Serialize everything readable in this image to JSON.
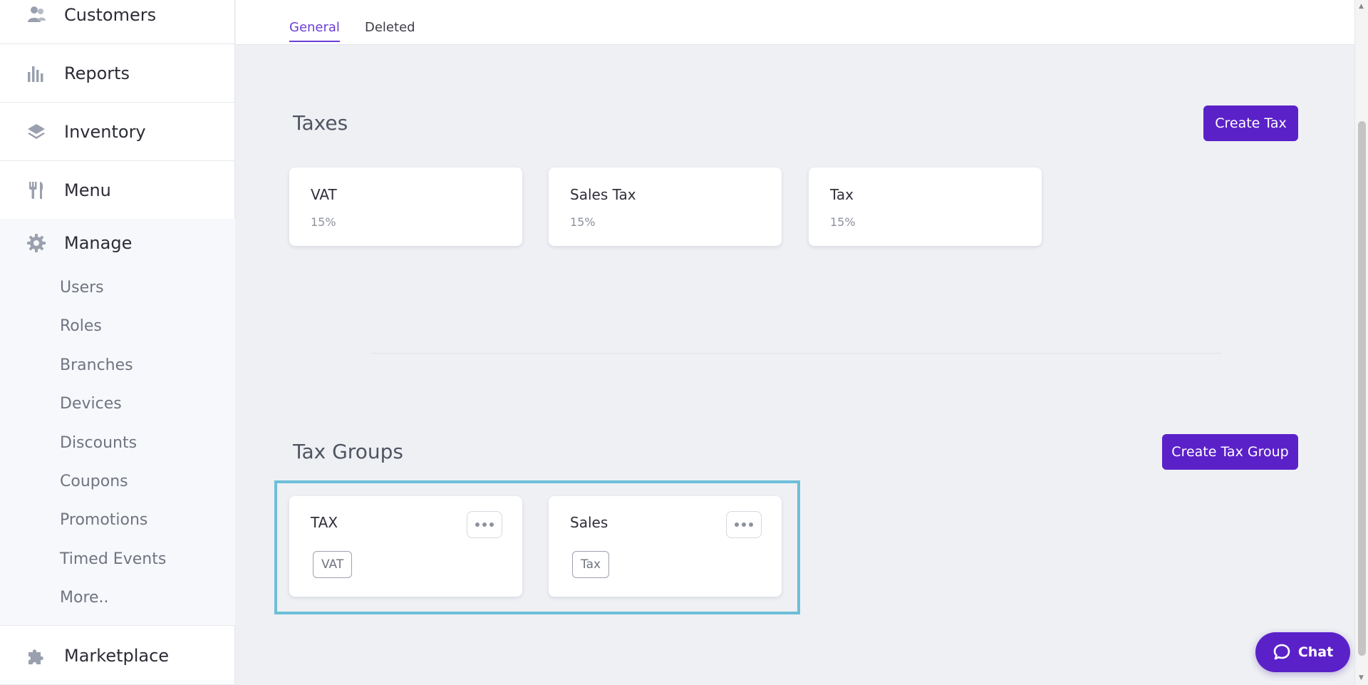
{
  "sidebar": {
    "customers": "Customers",
    "reports": "Reports",
    "inventory": "Inventory",
    "menu": "Menu",
    "manage": "Manage",
    "manage_items": [
      "Users",
      "Roles",
      "Branches",
      "Devices",
      "Discounts",
      "Coupons",
      "Promotions",
      "Timed Events",
      "More.."
    ],
    "marketplace": "Marketplace"
  },
  "tabs": {
    "general": "General",
    "deleted": "Deleted",
    "active": "General"
  },
  "taxes": {
    "title": "Taxes",
    "create_label": "Create Tax",
    "items": [
      {
        "name": "VAT",
        "rate": "15%"
      },
      {
        "name": "Sales Tax",
        "rate": "15%"
      },
      {
        "name": "Tax",
        "rate": "15%"
      }
    ]
  },
  "tax_groups": {
    "title": "Tax Groups",
    "create_label": "Create Tax Group",
    "items": [
      {
        "name": "TAX",
        "tax": "VAT"
      },
      {
        "name": "Sales",
        "tax": "Tax"
      }
    ]
  },
  "chat": {
    "label": "Chat"
  },
  "colors": {
    "accent": "#5b21c9",
    "active_tab": "#6b3fd6",
    "highlight": "#6dbfd8"
  }
}
